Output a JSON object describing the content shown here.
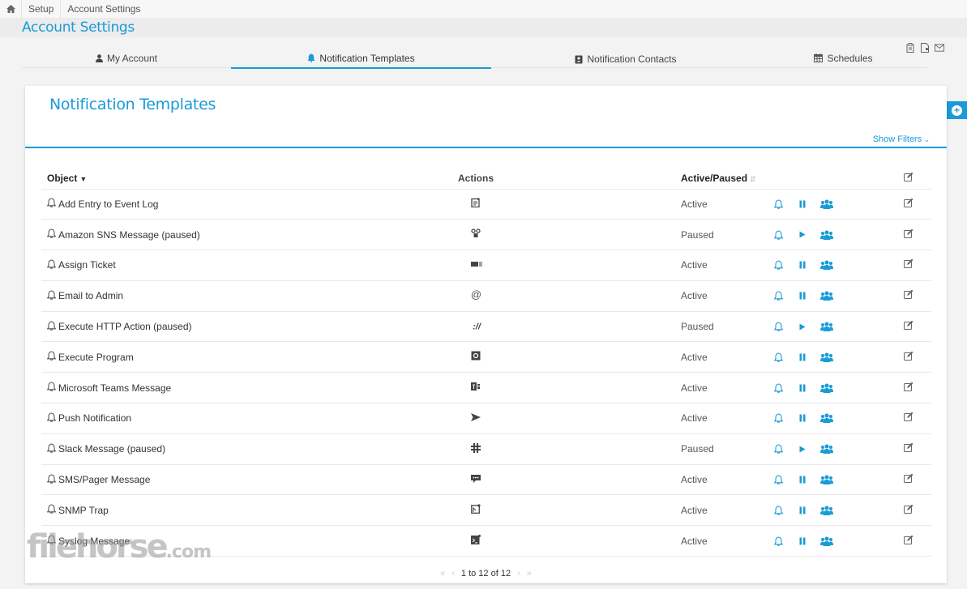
{
  "breadcrumb": {
    "home_icon": "home-icon",
    "items": [
      "Setup",
      "Account Settings"
    ]
  },
  "page_title": "Account Settings",
  "tabs": [
    {
      "label": "My Account",
      "icon": "user-icon",
      "active": false
    },
    {
      "label": "Notification Templates",
      "icon": "bell-icon",
      "active": true
    },
    {
      "label": "Notification Contacts",
      "icon": "contact-book-icon",
      "active": false
    },
    {
      "label": "Schedules",
      "icon": "calendar-icon",
      "active": false
    }
  ],
  "toolbar_icons": [
    "clipboard-icon",
    "add-document-icon",
    "envelope-icon"
  ],
  "add_button_icon": "plus-circle-icon",
  "panel": {
    "title": "Notification Templates",
    "show_filters": "Show Filters",
    "accent_color": "#1a9bd7"
  },
  "table": {
    "headers": {
      "object": "Object",
      "actions": "Actions",
      "status": "Active/Paused"
    },
    "rows": [
      {
        "name": "Add Entry to Event Log",
        "action_icon": "event-log-icon",
        "status": "Active",
        "toggle": "pause"
      },
      {
        "name": "Amazon SNS Message (paused)",
        "action_icon": "sns-icon",
        "status": "Paused",
        "toggle": "play"
      },
      {
        "name": "Assign Ticket",
        "action_icon": "ticket-icon",
        "status": "Active",
        "toggle": "pause"
      },
      {
        "name": "Email to Admin",
        "action_icon": "at-icon",
        "status": "Active",
        "toggle": "pause"
      },
      {
        "name": "Execute HTTP Action (paused)",
        "action_icon": "http-icon",
        "status": "Paused",
        "toggle": "play"
      },
      {
        "name": "Execute Program",
        "action_icon": "program-icon",
        "status": "Active",
        "toggle": "pause"
      },
      {
        "name": "Microsoft Teams Message",
        "action_icon": "teams-icon",
        "status": "Active",
        "toggle": "pause"
      },
      {
        "name": "Push Notification",
        "action_icon": "send-icon",
        "status": "Active",
        "toggle": "pause"
      },
      {
        "name": "Slack Message (paused)",
        "action_icon": "slack-icon",
        "status": "Paused",
        "toggle": "play"
      },
      {
        "name": "SMS/Pager Message",
        "action_icon": "sms-icon",
        "status": "Active",
        "toggle": "pause"
      },
      {
        "name": "SNMP Trap",
        "action_icon": "snmp-icon",
        "status": "Active",
        "toggle": "pause"
      },
      {
        "name": "Syslog Message",
        "action_icon": "syslog-icon",
        "status": "Active",
        "toggle": "pause"
      }
    ]
  },
  "pager": {
    "first": "«",
    "prev": "‹",
    "summary": "1 to 12 of 12",
    "next": "›",
    "last": "»"
  },
  "watermark": {
    "main": "filehorse",
    "suffix": ".com"
  }
}
